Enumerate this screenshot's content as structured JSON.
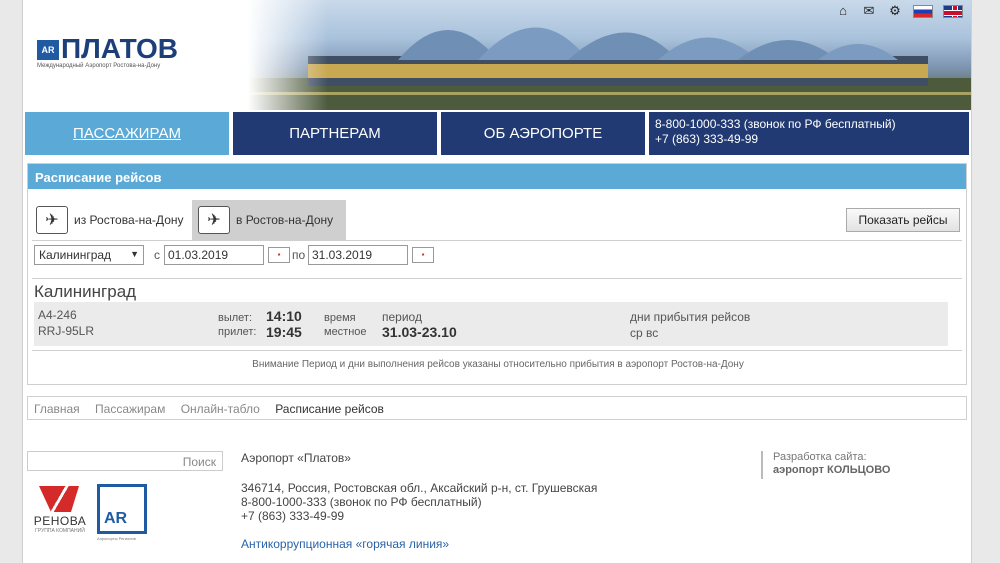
{
  "logo": {
    "mark": "AR",
    "name": "ПЛАТОВ",
    "subtitle": "Международный Аэропорт Ростова-на-Дону"
  },
  "nav": {
    "items": [
      "ПАССАЖИРАМ",
      "ПАРТНЕРАМ",
      "ОБ АЭРОПОРТЕ"
    ],
    "phone_line1": "8-800-1000-333 (звонок по РФ бесплатный)",
    "phone_line2": "+7 (863) 333-49-99"
  },
  "schedule": {
    "title": "Расписание рейсов",
    "tab_from": "из Ростова-на-Дону",
    "tab_to": "в Ростов-на-Дону",
    "show_button": "Показать рейсы",
    "city_select": "Калининград",
    "from_label": "с",
    "date_from": "01.03.2019",
    "to_label": "по",
    "date_to": "31.03.2019",
    "result_city": "Калининград",
    "flight": {
      "number": "А4-246",
      "aircraft": "RRJ-95LR",
      "depart_label": "вылет:",
      "depart_time": "14:10",
      "arrive_label": "прилет:",
      "arrive_time": "19:45",
      "time_label": "время",
      "local_label": "местное",
      "period_label": "период",
      "period": "31.03-23.10",
      "days_label": "дни прибытия рейсов",
      "days": "ср вс"
    },
    "notice": "Внимание Период и дни выполнения рейсов указаны относительно прибытия в аэропорт Ростов-на-Дону"
  },
  "breadcrumb": [
    "Главная",
    "Пассажирам",
    "Онлайн-табло",
    "Расписание рейсов"
  ],
  "footer": {
    "search_placeholder": "Поиск",
    "renova_name": "РЕНОВА",
    "renova_sub": "ГРУППА КОМПАНИЙ",
    "ar_mark": "AR",
    "ar_sub": "Аэропорты Регионов",
    "airport_title": "Аэропорт «Платов»",
    "address": "346714, Россия, Ростовская обл., Аксайский р-н, ст. Грушевская",
    "phone1": "8-800-1000-333 (звонок по РФ бесплатный)",
    "phone2": "+7 (863) 333-49-99",
    "anticorruption": "Антикоррупционная «горячая линия»",
    "dev_label": "Разработка сайта:",
    "dev_name": "аэропорт КОЛЬЦОВО"
  }
}
